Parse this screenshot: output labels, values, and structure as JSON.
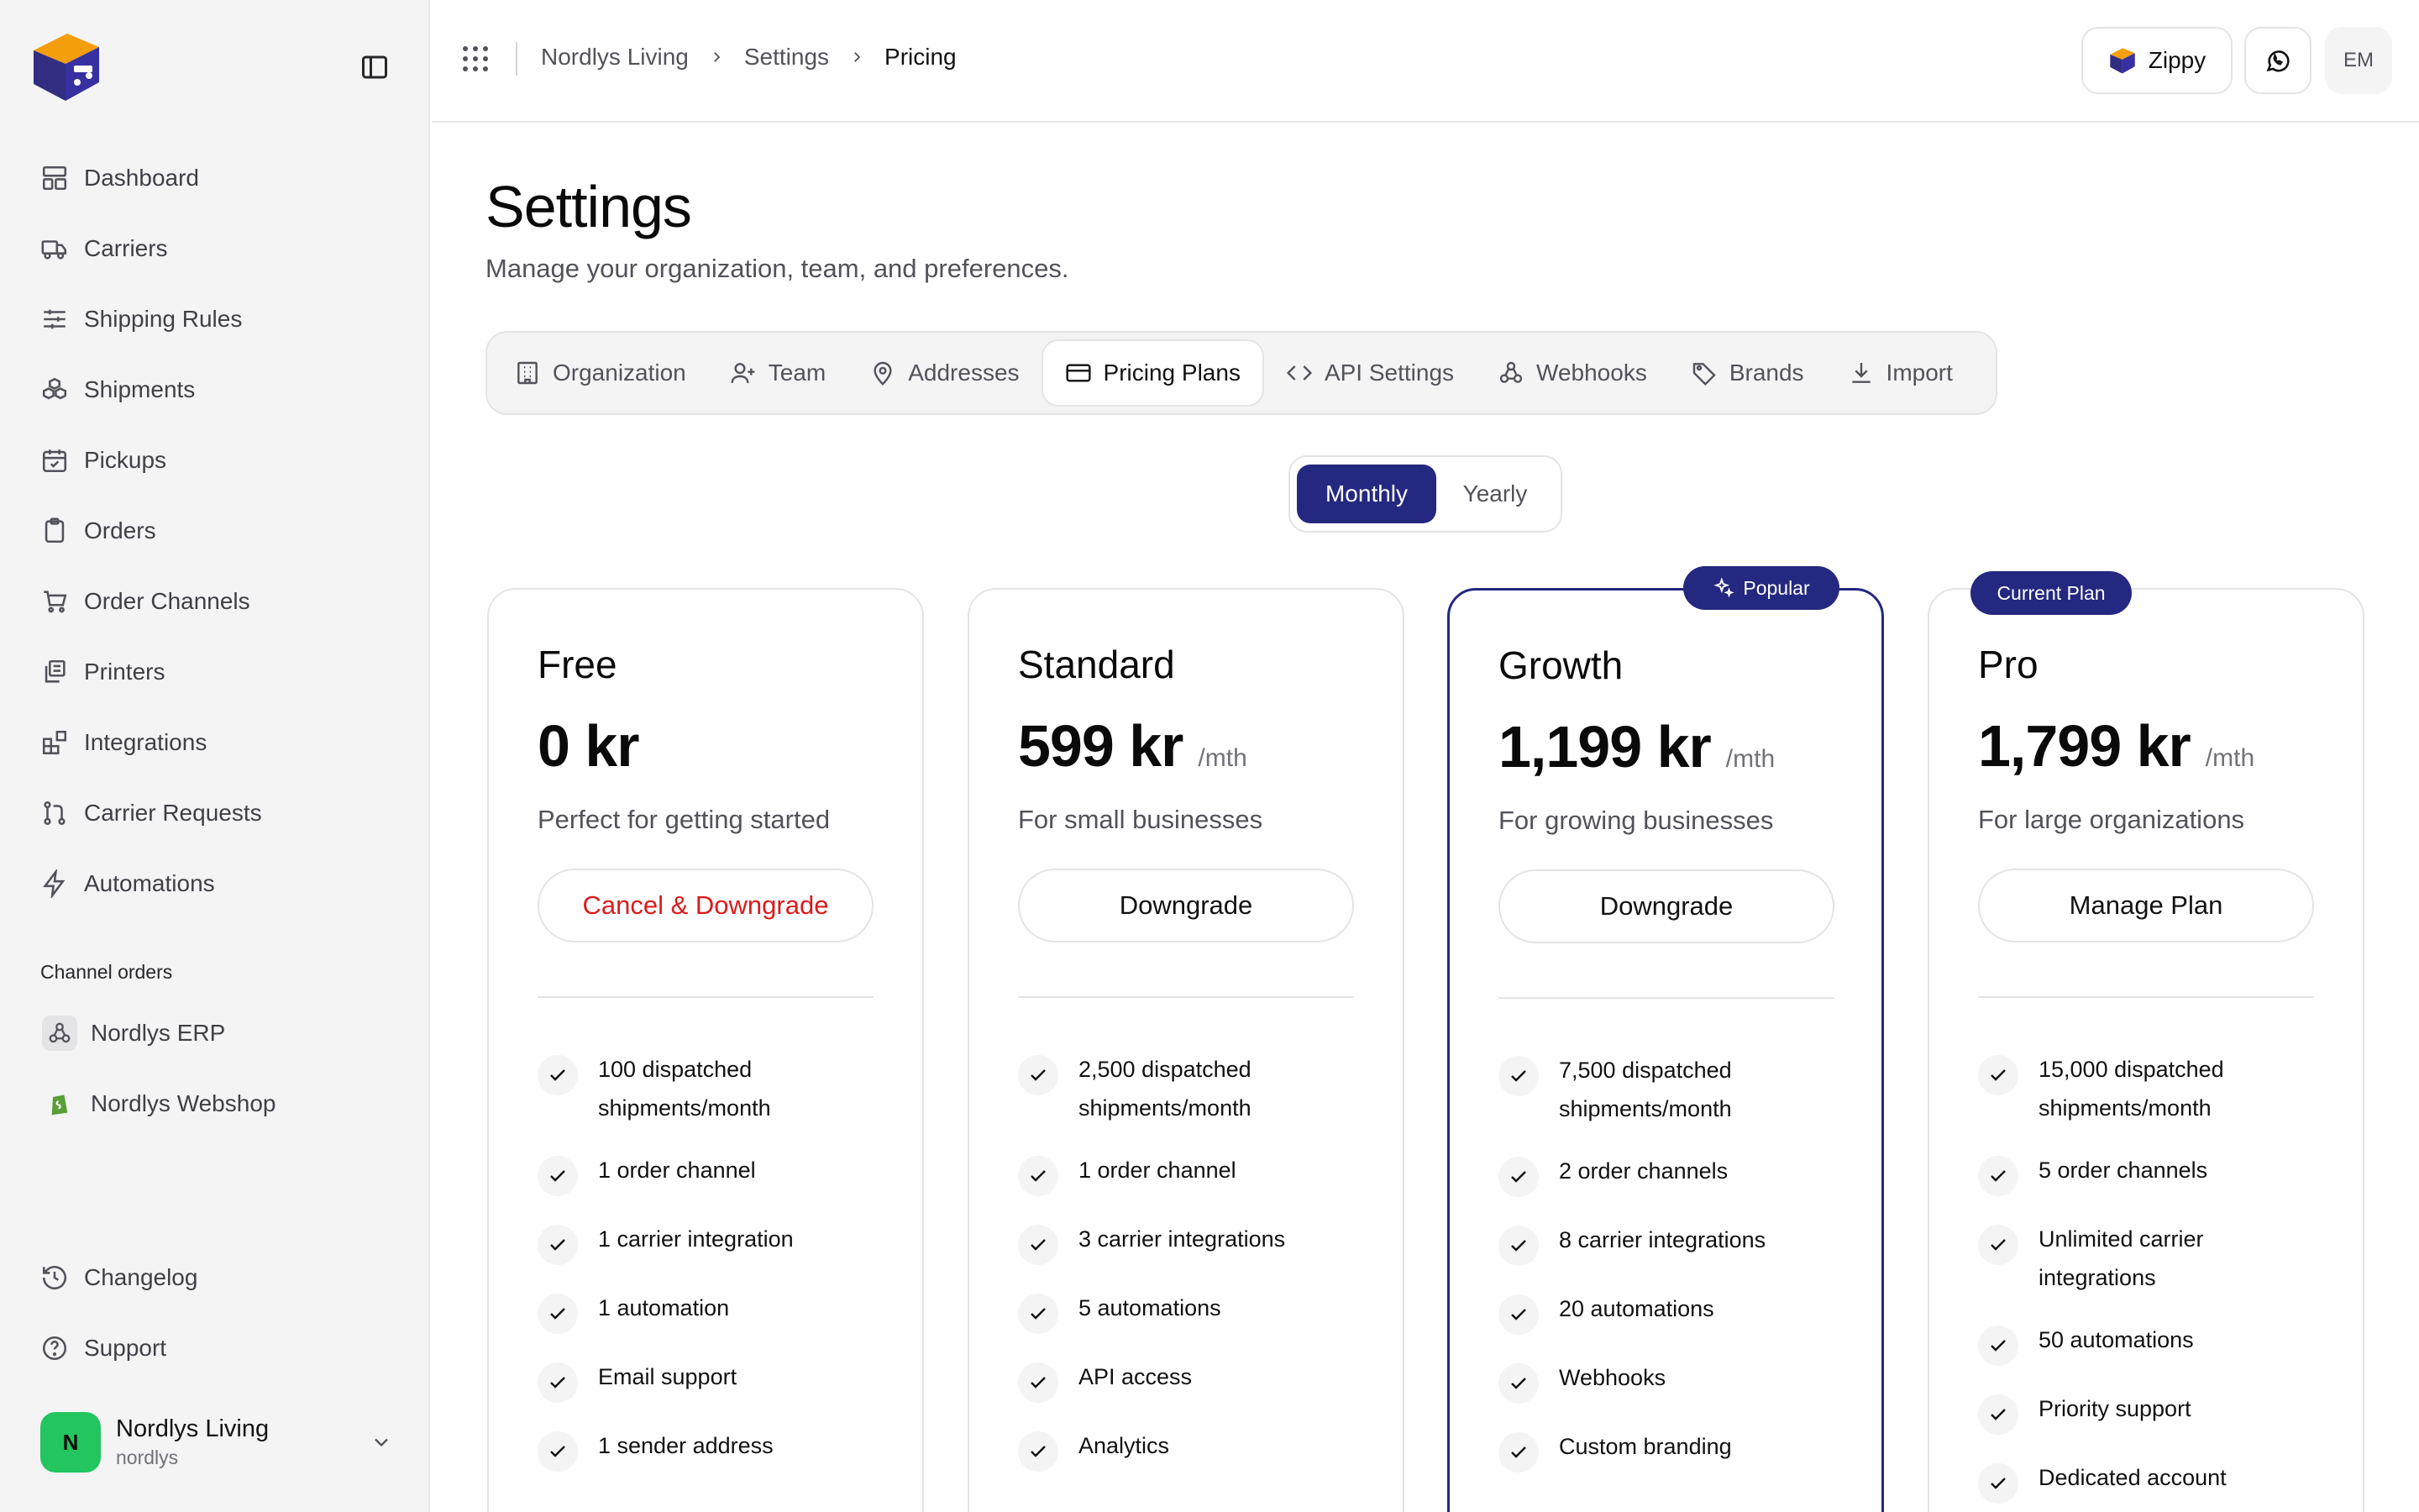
{
  "sidebar": {
    "nav": [
      {
        "label": "Dashboard",
        "icon": "dashboard-icon"
      },
      {
        "label": "Carriers",
        "icon": "truck-icon"
      },
      {
        "label": "Shipping Rules",
        "icon": "sliders-icon"
      },
      {
        "label": "Shipments",
        "icon": "boxes-icon"
      },
      {
        "label": "Pickups",
        "icon": "calendar-icon"
      },
      {
        "label": "Orders",
        "icon": "clipboard-icon"
      },
      {
        "label": "Order Channels",
        "icon": "cart-icon"
      },
      {
        "label": "Printers",
        "icon": "printer-icon"
      },
      {
        "label": "Integrations",
        "icon": "blocks-icon"
      },
      {
        "label": "Carrier Requests",
        "icon": "git-pull-icon"
      },
      {
        "label": "Automations",
        "icon": "zap-icon"
      }
    ],
    "channels_title": "Channel orders",
    "channels": [
      {
        "label": "Nordlys ERP",
        "icon": "webhook-icon"
      },
      {
        "label": "Nordlys Webshop",
        "icon": "shopify-icon"
      }
    ],
    "footer": {
      "changelog": "Changelog",
      "support": "Support"
    },
    "org": {
      "initial": "N",
      "name": "Nordlys Living",
      "slug": "nordlys",
      "accent": "#22c55e"
    }
  },
  "topbar": {
    "breadcrumbs": [
      "Nordlys Living",
      "Settings",
      "Pricing"
    ],
    "zippy": "Zippy",
    "user_initials": "EM"
  },
  "page": {
    "title": "Settings",
    "subtitle": "Manage your organization, team, and preferences."
  },
  "tabs": [
    {
      "label": "Organization",
      "icon": "building-icon"
    },
    {
      "label": "Team",
      "icon": "user-plus-icon"
    },
    {
      "label": "Addresses",
      "icon": "map-pin-icon"
    },
    {
      "label": "Pricing Plans",
      "icon": "credit-card-icon",
      "active": true
    },
    {
      "label": "API Settings",
      "icon": "code-icon"
    },
    {
      "label": "Webhooks",
      "icon": "webhook-icon"
    },
    {
      "label": "Brands",
      "icon": "tag-icon"
    },
    {
      "label": "Import",
      "icon": "download-icon"
    }
  ],
  "billing": {
    "monthly": "Monthly",
    "yearly": "Yearly",
    "selected": "Monthly"
  },
  "plans": [
    {
      "name": "Free",
      "price": "0 kr",
      "period": "",
      "desc": "Perfect for getting started",
      "cta": "Cancel & Downgrade",
      "features": [
        "100 dispatched shipments/month",
        "1 order channel",
        "1 carrier integration",
        "1 automation",
        "Email support",
        "1 sender address"
      ]
    },
    {
      "name": "Standard",
      "price": "599 kr",
      "period": "/mth",
      "desc": "For small businesses",
      "cta": "Downgrade",
      "features": [
        "2,500 dispatched shipments/month",
        "1 order channel",
        "3 carrier integrations",
        "5 automations",
        "API access",
        "Analytics"
      ]
    },
    {
      "name": "Growth",
      "price": "1,199 kr",
      "period": "/mth",
      "desc": "For growing businesses",
      "cta": "Downgrade",
      "badge": "Popular",
      "features": [
        "7,500 dispatched shipments/month",
        "2 order channels",
        "8 carrier integrations",
        "20 automations",
        "Webhooks",
        "Custom branding"
      ]
    },
    {
      "name": "Pro",
      "price": "1,799 kr",
      "period": "/mth",
      "desc": "For large organizations",
      "cta": "Manage Plan",
      "badge": "Current Plan",
      "features": [
        "15,000 dispatched shipments/month",
        "5 order channels",
        "Unlimited carrier integrations",
        "50 automations",
        "Priority support",
        "Dedicated account"
      ]
    }
  ],
  "colors": {
    "accent": "#242880",
    "danger": "#dc1b1b",
    "logo_orange": "#f59e0b",
    "logo_indigo": "#312e81"
  }
}
